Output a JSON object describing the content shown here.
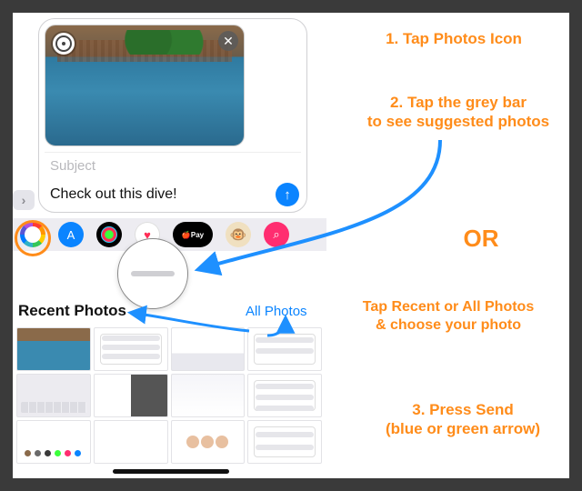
{
  "instructions": {
    "step1": "1. Tap Photos Icon",
    "step2_line1": "2. Tap the grey bar",
    "step2_line2": "to see suggested photos",
    "or": "OR",
    "step_tabs_line1": "Tap Recent or All Photos",
    "step_tabs_line2": "& choose your photo",
    "step3_line1": "3. Press Send",
    "step3_line2": "(blue or green arrow)"
  },
  "compose": {
    "subject_placeholder": "Subject",
    "body_text": "Check out this dive!",
    "send_glyph": "↑",
    "close_glyph": "✕",
    "chevron_glyph": "›"
  },
  "drawer": {
    "apps": [
      "photos",
      "appstore",
      "activity",
      "heart",
      "pay",
      "animoji",
      "search"
    ],
    "applepay_label": "🍎Pay",
    "monkey_glyph": "🐵",
    "search_glyph": "⌕",
    "heart_glyph": "♥",
    "a_glyph": "A"
  },
  "tabs": {
    "recent": "Recent Photos",
    "all": "All Photos"
  },
  "colors": {
    "accent_orange": "#ff8c1a",
    "ios_blue": "#0a84ff",
    "arrow_blue": "#1e90ff"
  }
}
